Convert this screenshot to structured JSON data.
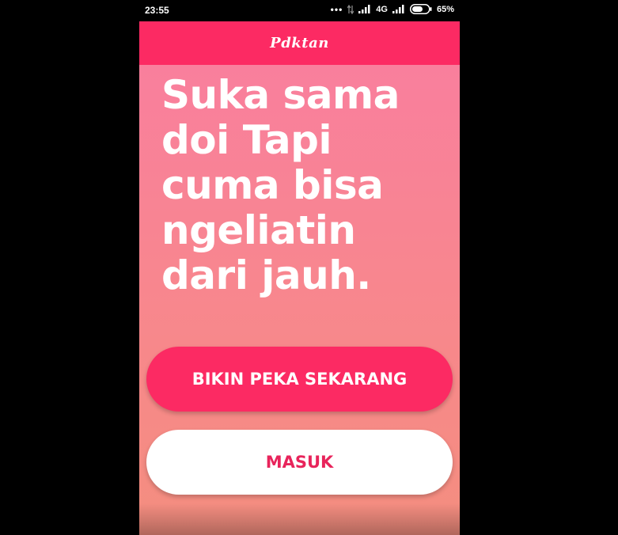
{
  "statusbar": {
    "time": "23:55",
    "network": "4G",
    "battery": "65%",
    "battery_level": 0.65
  },
  "appbar": {
    "logo": "Pdktan"
  },
  "main": {
    "headline": "Suka sama doi Tapi cuma bisa ngeliatin dari jauh.",
    "primary_button": "BIKIN PEKA SEKARANG",
    "secondary_button": "MASUK"
  },
  "colors": {
    "brand": "#fc2a63",
    "gradient_top": "#f97f9d",
    "gradient_bottom": "#f48e7f",
    "secondary_text": "#e8245b"
  }
}
